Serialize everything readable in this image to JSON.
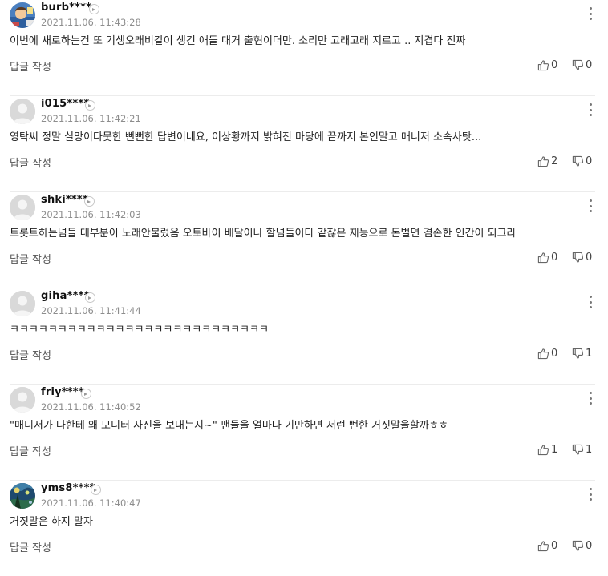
{
  "comments": [
    {
      "nick": "burb****",
      "date": "2021.11.06. 11:43:28",
      "text": "이번에 새로하는건 또 기생오래비같이 생긴 애들 대거 출현이더만. 소리만 고래고래 지르고 .. 지겹다 진짜",
      "reply": "답글 작성",
      "likes": "0",
      "dislikes": "0",
      "avatar": "photo"
    },
    {
      "nick": "i015****",
      "date": "2021.11.06. 11:42:21",
      "text": "영탁씨 정말 실망이다뭇한 뻔뻔한 답변이네요, 이상황까지 밝혀진 마당에 끝까지 본인말고 매니저 소속사탓...",
      "reply": "답글 작성",
      "likes": "2",
      "dislikes": "0",
      "avatar": "default"
    },
    {
      "nick": "shki****",
      "date": "2021.11.06. 11:42:03",
      "text": "트롯트하는넘들 대부분이 노래안불렀음 오토바이 배달이나 할넘들이다 같잖은 재능으로 돈벌면 겸손한 인간이 되그라",
      "reply": "답글 작성",
      "likes": "0",
      "dislikes": "0",
      "avatar": "default"
    },
    {
      "nick": "giha****",
      "date": "2021.11.06. 11:41:44",
      "text": "ㅋㅋㅋㅋㅋㅋㅋㅋㅋㅋㅋㅋㅋㅋㅋㅋㅋㅋㅋㅋㅋㅋㅋㅋㅋㅋㅋ",
      "reply": "답글 작성",
      "likes": "0",
      "dislikes": "1",
      "avatar": "default"
    },
    {
      "nick": "friy****",
      "date": "2021.11.06. 11:40:52",
      "text": "\"매니저가 나한테 왜 모니터 사진을 보내는지~\" 팬들을 얼마나 기만하면 저런 뻔한 거짓말을할까ㅎㅎ",
      "reply": "답글 작성",
      "likes": "1",
      "dislikes": "1",
      "avatar": "default"
    },
    {
      "nick": "yms8****",
      "date": "2021.11.06. 11:40:47",
      "text": "거짓말은 하지 말자",
      "reply": "답글 작성",
      "likes": "0",
      "dislikes": "0",
      "avatar": "painting"
    }
  ],
  "icons": {
    "more": "more-vertical-icon",
    "profile": "chevron-right-circle-icon",
    "like": "thumbs-up-icon",
    "dislike": "thumbs-down-icon"
  },
  "colors": {
    "nick": "#111111",
    "date": "#8d8d8d",
    "text": "#222222",
    "divider": "#ececec",
    "icon": "#666666"
  }
}
